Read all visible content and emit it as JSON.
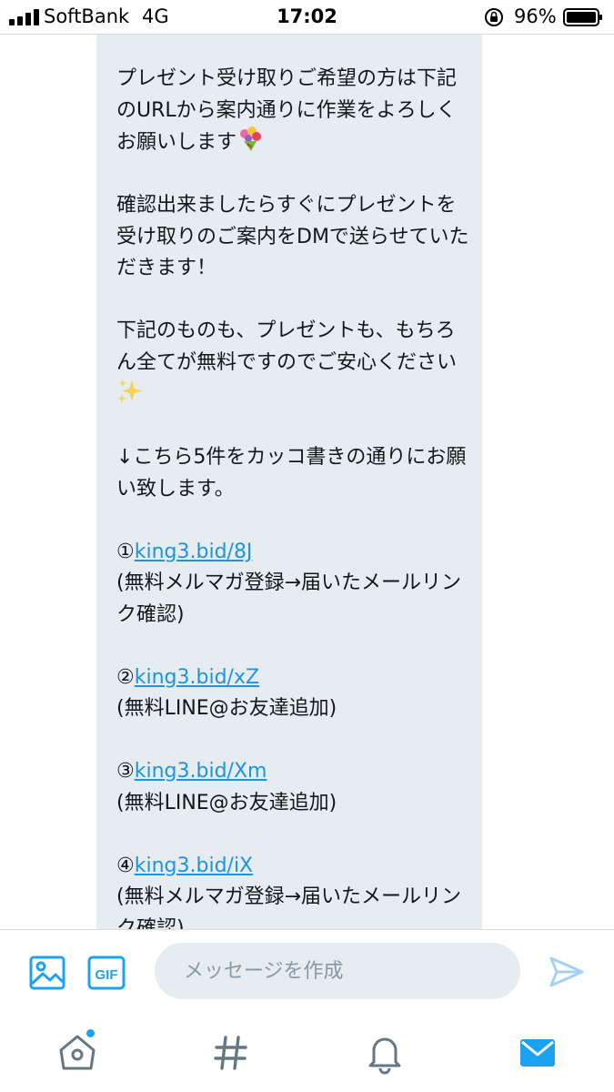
{
  "status": {
    "carrier": "SoftBank",
    "network": "4G",
    "time": "17:02",
    "battery": "96%"
  },
  "message": {
    "p1": "プレゼント受け取りご希望の方は下記のURLから案内通りに作業をよろしくお願いします",
    "p2": "確認出来ましたらすぐにプレゼントを受け取りのご案内をDMで送らせていただきます！",
    "p3": "下記のものも、プレゼントも、もちろん全てが無料ですのでご安心ください",
    "p4": "↓こちら5件をカッコ書きの通りにお願い致します。",
    "items": [
      {
        "num": "①",
        "link": "king3.bid/8J",
        "note": " (無料メルマガ登録→届いたメールリンク確認)"
      },
      {
        "num": "②",
        "link": "king3.bid/xZ",
        "note": "(無料LINE@お友達追加)"
      },
      {
        "num": "③",
        "link": "king3.bid/Xm",
        "note": "(無料LINE@お友達追加)"
      },
      {
        "num": "④",
        "link": "king3.bid/iX",
        "note": " (無料メルマガ登録→届いたメールリンク確認)"
      }
    ]
  },
  "composer": {
    "placeholder": "メッセージを作成",
    "gif_label": "GIF"
  },
  "icons": {
    "media": "image-icon",
    "gif": "gif-icon",
    "send": "send-icon",
    "home": "home-icon",
    "explore": "hashtag-icon",
    "notifications": "bell-icon",
    "messages": "envelope-icon"
  },
  "colors": {
    "accent": "#1da1f2",
    "link": "#1b95e0",
    "bubble": "#e6ecf0"
  }
}
